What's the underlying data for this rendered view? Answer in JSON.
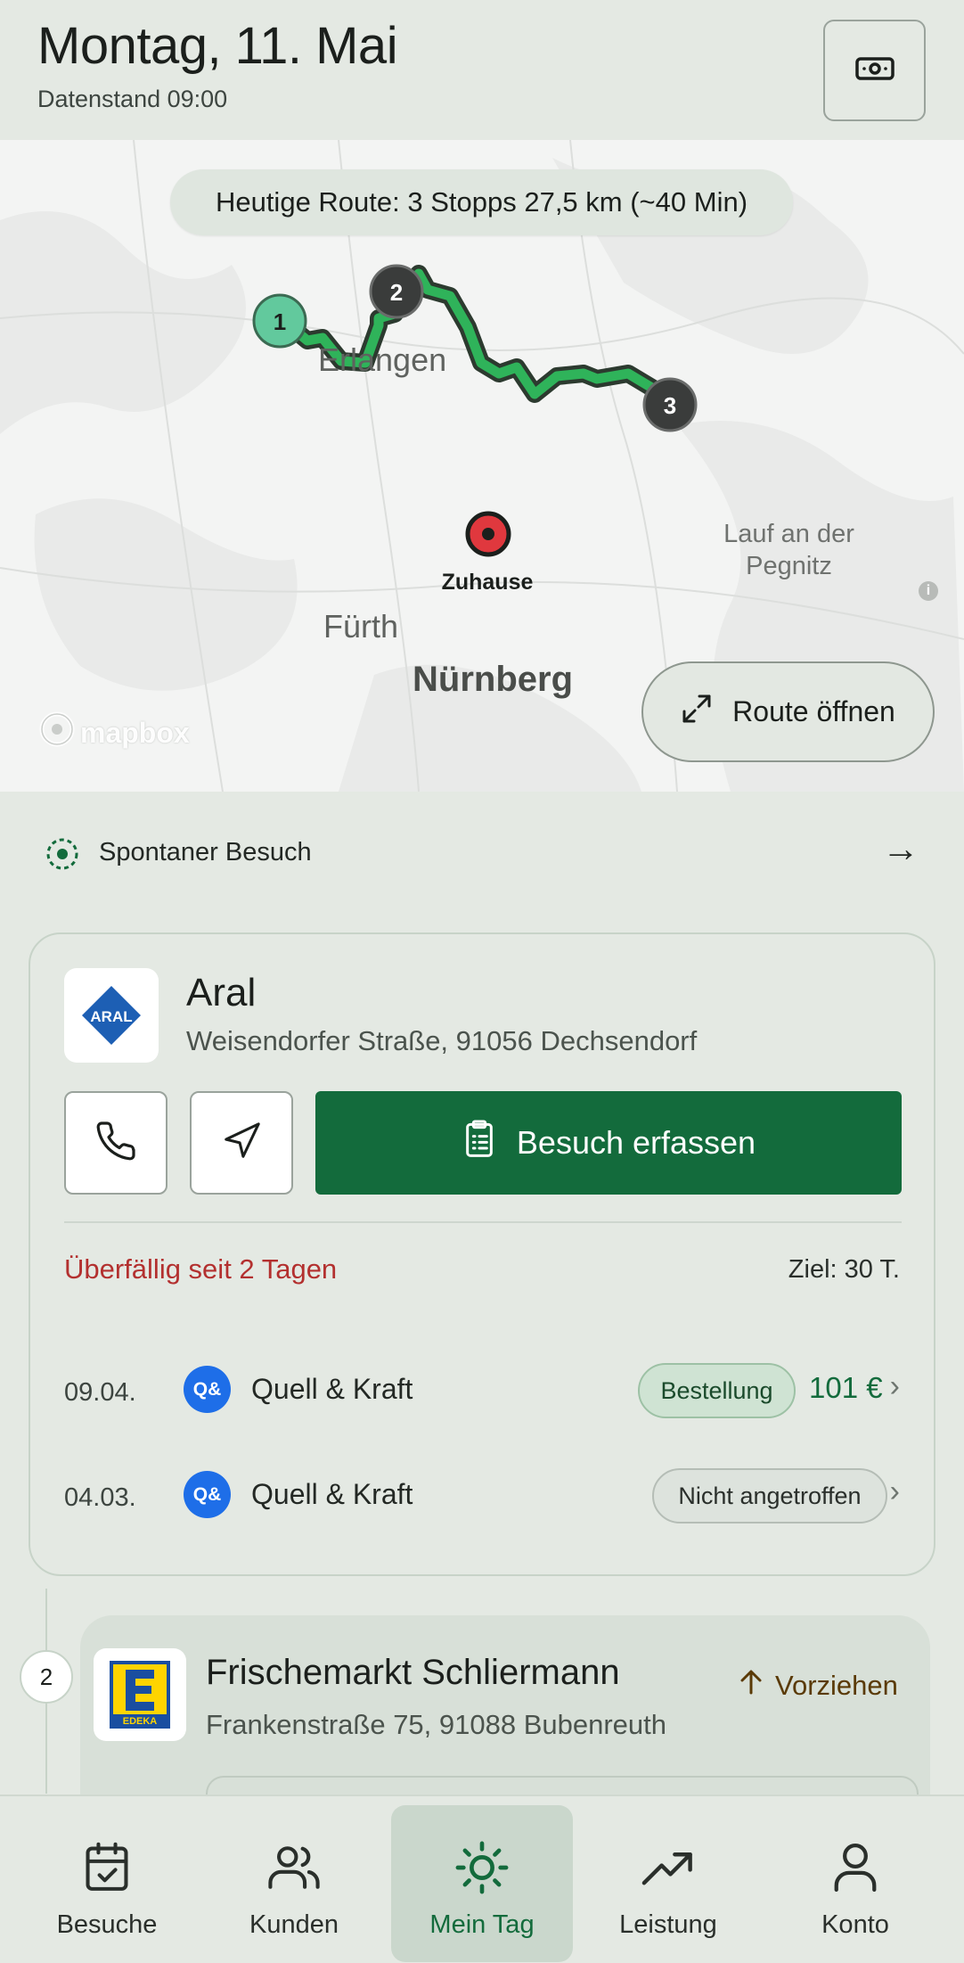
{
  "header": {
    "title": "Montag, 11. Mai",
    "subtitle": "Datenstand 09:00",
    "cash_icon": "banknote-icon"
  },
  "map": {
    "route_summary": "Heutige Route: 3 Stopps 27,5 km (~40 Min)",
    "stops": [
      "1",
      "2",
      "3"
    ],
    "labels": {
      "erlangen": "Erlangen",
      "fuerth": "Fürth",
      "nuernberg": "Nürnberg",
      "lauf": "Lauf an der Pegnitz",
      "home": "Zuhause"
    },
    "attribution": "mapbox",
    "route_button": "Route öffnen",
    "colors": {
      "route": "#2fb35a",
      "route_outline": "#2c3a2f",
      "stop1": "#62c99d",
      "stop_dark": "#3a3c3b",
      "home": "#e0383e"
    }
  },
  "spontaneous": {
    "label": "Spontaner Besuch",
    "arrow": "→"
  },
  "current_stop": {
    "name": "Aral",
    "address": "Weisendorfer Straße, 91056 Dechsendorf",
    "logo_text": "ARAL",
    "primary_action": "Besuch erfassen",
    "overdue": "Überfällig seit 2 Tagen",
    "target": "Ziel: 30 T.",
    "history": [
      {
        "date": "09.04.",
        "avatar": "Q&",
        "supplier": "Quell & Kraft",
        "tag": "Bestellung",
        "amount": "101 €"
      },
      {
        "date": "04.03.",
        "avatar": "Q&",
        "supplier": "Quell & Kraft",
        "tag": "Nicht angetroffen",
        "amount": ""
      }
    ]
  },
  "next_stop": {
    "step": "2",
    "name": "Frischemarkt Schliermann",
    "address": "Frankenstraße 75, 91088 Bubenreuth",
    "logo_text": "EDEKA",
    "action": "Vorziehen"
  },
  "nav": {
    "items": [
      {
        "label": "Besuche",
        "icon": "calendar-check-icon"
      },
      {
        "label": "Kunden",
        "icon": "users-icon"
      },
      {
        "label": "Mein Tag",
        "icon": "sun-icon",
        "active": true
      },
      {
        "label": "Leistung",
        "icon": "trending-up-icon"
      },
      {
        "label": "Konto",
        "icon": "user-icon"
      }
    ]
  },
  "theme": {
    "accent": "#136b3c",
    "overdue": "#b3302f",
    "background": "#e4e9e3"
  }
}
